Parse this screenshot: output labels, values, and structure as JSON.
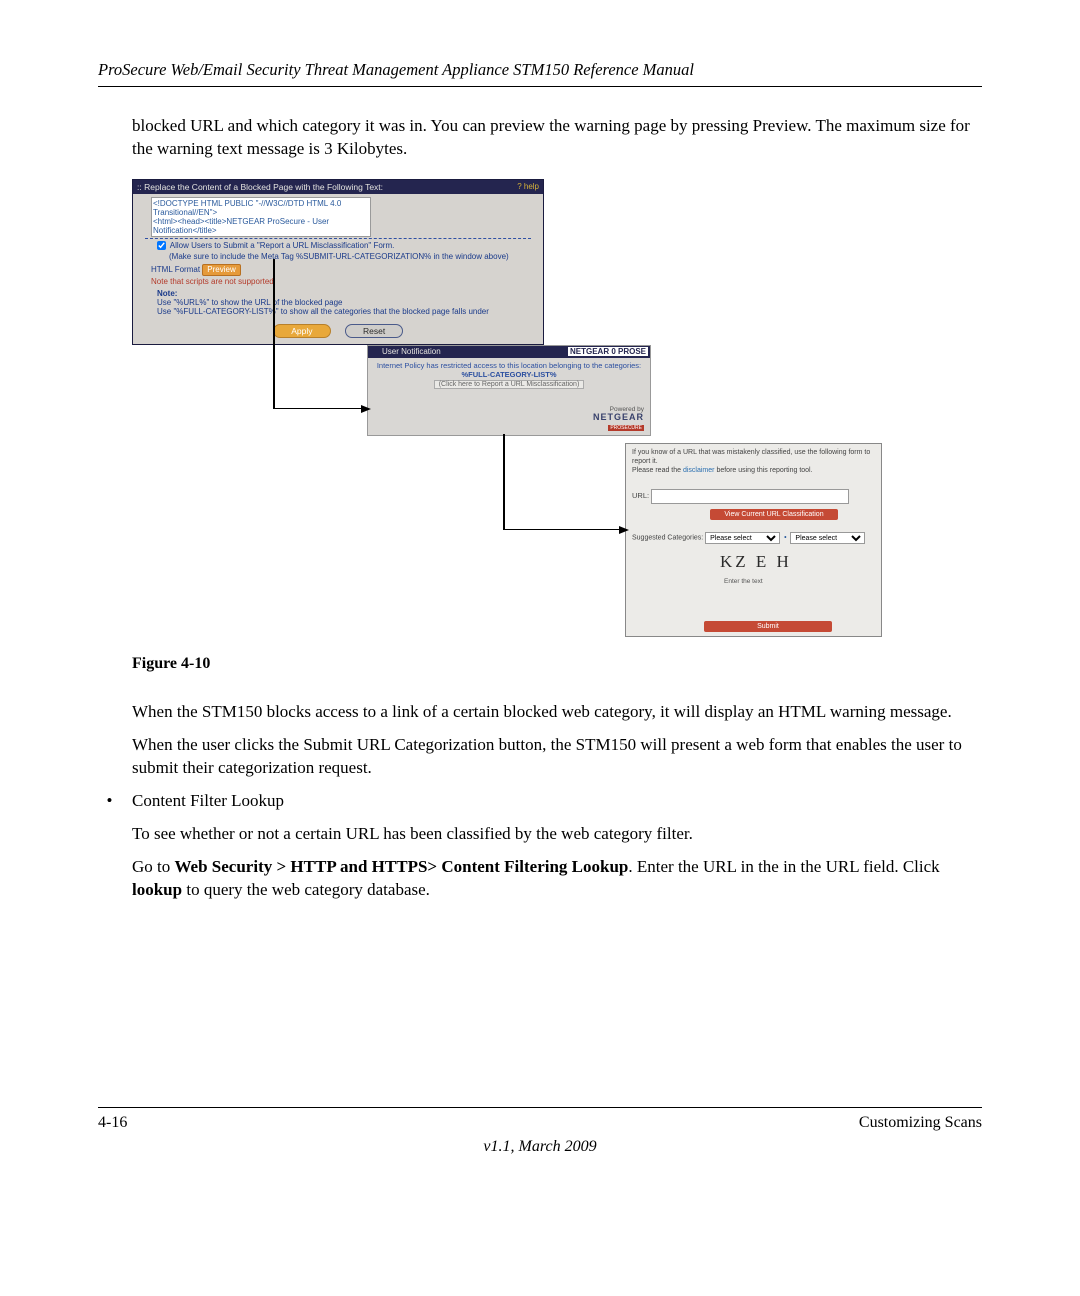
{
  "header": "ProSecure Web/Email Security Threat Management Appliance STM150 Reference Manual",
  "intro": "blocked URL and which category it was in. You can preview the warning page by pressing Preview. The maximum size for the warning text message is 3 Kilobytes.",
  "panel1": {
    "title": "::  Replace the Content of a Blocked Page with the Following Text:",
    "help": "? help",
    "textarea_value": "<!DOCTYPE HTML PUBLIC \"-//W3C//DTD HTML 4.0 Transitional//EN\">\n<html><head><title>NETGEAR ProSecure - User Notification</title>",
    "allow_line": "Allow Users to Submit a \"Report a URL Misclassification\" Form.",
    "meta_line": "(Make sure to include the Meta Tag %SUBMIT-URL-CATEGORIZATION% in the window above)",
    "html_format": "HTML Format",
    "preview": "Preview",
    "scripts_note": "Note that scripts are not supported",
    "note_label": "Note:",
    "note1": "Use \"%URL%\" to show the URL of the blocked page",
    "note2": "Use \"%FULL-CATEGORY-LIST%\" to show all the categories that the blocked page falls under",
    "apply": "Apply",
    "reset": "Reset"
  },
  "panel2": {
    "tab": "User Notification",
    "badge": "NETGEAR 0 PROSE",
    "line1": "Internet Policy has restricted access to this location belonging to the categories:",
    "catlist": "%FULL-CATEGORY-LIST%",
    "clicklink": "(Click here to Report a URL Misclassification)",
    "powered": "Powered by",
    "logo": "NETGEAR",
    "secure": "PROSECURE"
  },
  "panel3": {
    "msg_a": "If you know of a URL that was mistakenly classified, use the following form to report it.",
    "msg_b": "Please read the ",
    "disclaimer": "disclaimer",
    "msg_c": " before using this reporting tool.",
    "url_label": "URL:",
    "view_btn": "View Current URL Classification",
    "sug_label": "Suggested Categories:",
    "sug_option": "Please select",
    "captcha": "KZ E H",
    "enter": "Enter the text",
    "submit": "Submit"
  },
  "fig_caption": "Figure 4-10",
  "para1": "When the STM150 blocks access to a link of a certain blocked web category, it will display an HTML warning message.",
  "para2": "When the user clicks the Submit URL Categorization button, the STM150 will present a web form that enables the user to submit their categorization request.",
  "bullet": {
    "title": "Content Filter Lookup",
    "line1": "To see whether or not a certain URL has been classified by the web category filter.",
    "line2a": "Go to ",
    "line2bold": "Web Security > HTTP and HTTPS> Content Filtering Lookup",
    "line2b": ". Enter the URL in the in the URL field. Click ",
    "line2bold2": "lookup",
    "line2c": " to query the web category database."
  },
  "footer": {
    "left": "4-16",
    "right": "Customizing Scans",
    "version": "v1.1, March 2009"
  }
}
